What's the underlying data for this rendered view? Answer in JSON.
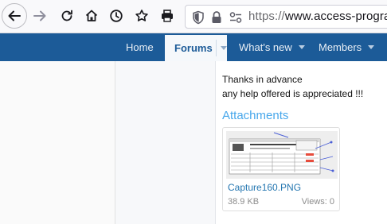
{
  "browser": {
    "url_scheme": "https://",
    "url_rest": "www.access-program",
    "icons": [
      "back-arrow-icon",
      "forward-arrow-icon",
      "reload-icon",
      "home-icon",
      "history-clock-icon",
      "bookmark-star-icon",
      "print-icon",
      "shield-icon",
      "lock-icon",
      "permissions-icon"
    ]
  },
  "nav": {
    "home": "Home",
    "forums": "Forums",
    "whats_new": "What's new",
    "members": "Members"
  },
  "post": {
    "line1": "Thanks in advance",
    "line2": "any help offered is appreciated !!!"
  },
  "attachments": {
    "heading": "Attachments",
    "items": [
      {
        "name": "Capture160.PNG",
        "size": "38.9 KB",
        "views": "Views: 0"
      }
    ]
  },
  "colors": {
    "nav_bg": "#1c5b98",
    "accent": "#47a7eb",
    "link": "#2577b1"
  }
}
